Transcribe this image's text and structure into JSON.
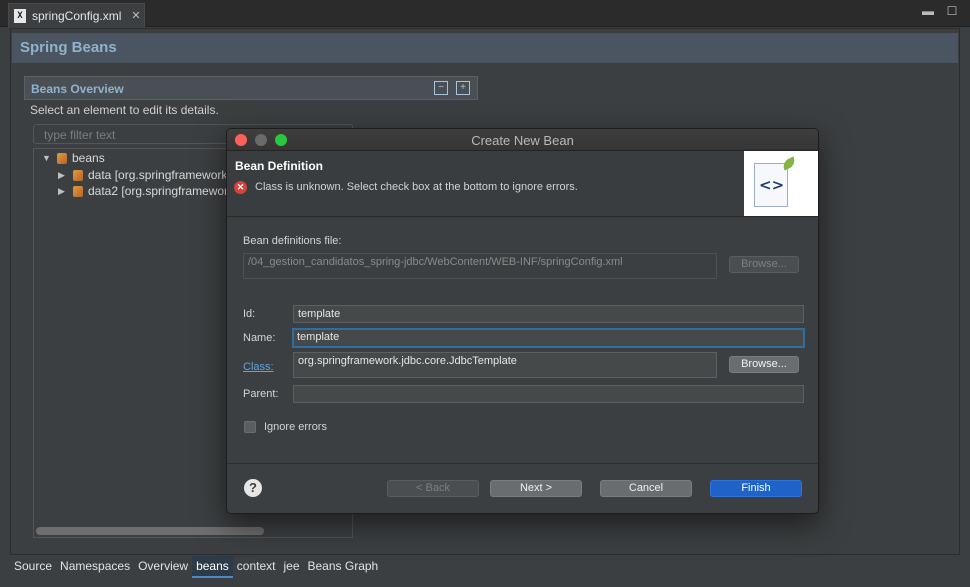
{
  "editor_tab": {
    "label": "springConfig.xml",
    "icon": "xml-file-icon"
  },
  "form": {
    "title": "Spring Beans"
  },
  "overview": {
    "title": "Beans Overview",
    "description": "Select an element to edit its details.",
    "filter_placeholder": "type filter text",
    "tree": {
      "root": "beans",
      "children": [
        "data [org.springframework",
        "data2 [org.springframework"
      ]
    }
  },
  "page_tabs": [
    "Source",
    "Namespaces",
    "Overview",
    "beans",
    "context",
    "jee",
    "Beans Graph"
  ],
  "active_page_tab": "beans",
  "dialog": {
    "title": "Create New Bean",
    "banner_title": "Bean Definition",
    "error_message": "Class is unknown. Select check box at the bottom to ignore errors.",
    "defs_file_label": "Bean definitions file:",
    "defs_file_value": "/04_gestion_candidatos_spring-jdbc/WebContent/WEB-INF/springConfig.xml",
    "browse_disabled": "Browse...",
    "id_label": "Id:",
    "id_value": "template",
    "name_label": "Name:",
    "name_value": "template",
    "class_label": "Class:",
    "class_value": "org.springframework.jdbc.core.JdbcTemplate",
    "browse": "Browse...",
    "parent_label": "Parent:",
    "parent_value": "",
    "ignore_errors_label": "Ignore errors",
    "ignore_errors_checked": false,
    "buttons": {
      "back": "< Back",
      "next": "Next >",
      "cancel": "Cancel",
      "finish": "Finish"
    },
    "help_glyph": "?",
    "wizard_glyph": "<>"
  },
  "colors": {
    "accent": "#1f63c9",
    "error": "#d9413a",
    "link": "#5aa4e8",
    "header_text": "#8fb3cc"
  }
}
